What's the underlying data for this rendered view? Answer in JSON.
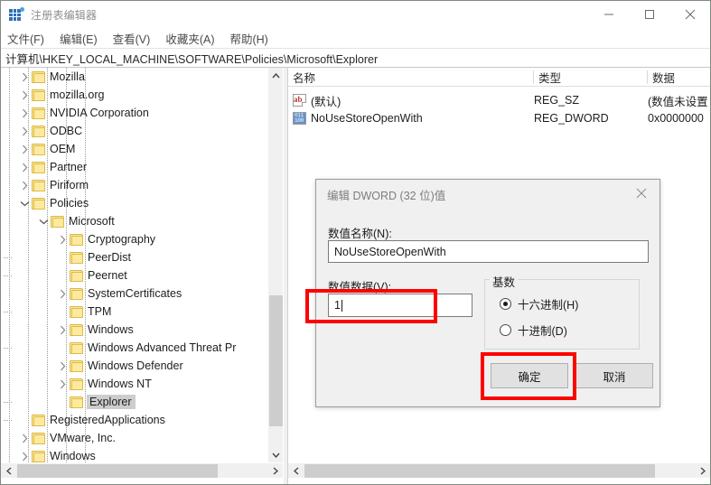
{
  "window": {
    "title": "注册表编辑器",
    "icon": "registry-editor-icon",
    "minimize_label": "—",
    "maximize_label": "□",
    "close_label": "✕"
  },
  "menubar": {
    "items": [
      {
        "label": "文件(F)",
        "text": "文件",
        "key": "F"
      },
      {
        "label": "编辑(E)",
        "text": "编辑",
        "key": "E"
      },
      {
        "label": "查看(V)",
        "text": "查看",
        "key": "V"
      },
      {
        "label": "收藏夹(A)",
        "text": "收藏夹",
        "key": "A"
      },
      {
        "label": "帮助(H)",
        "text": "帮助",
        "key": "H"
      }
    ]
  },
  "address": {
    "path": "计算机\\HKEY_LOCAL_MACHINE\\SOFTWARE\\Policies\\Microsoft\\Explorer"
  },
  "tree": {
    "nodes": [
      {
        "label": "Mozilla",
        "depth": 2,
        "expander": "collapsed",
        "selected": false
      },
      {
        "label": "mozilla.org",
        "depth": 2,
        "expander": "collapsed",
        "selected": false
      },
      {
        "label": "NVIDIA Corporation",
        "depth": 2,
        "expander": "collapsed",
        "selected": false
      },
      {
        "label": "ODBC",
        "depth": 2,
        "expander": "collapsed",
        "selected": false
      },
      {
        "label": "OEM",
        "depth": 2,
        "expander": "collapsed",
        "selected": false
      },
      {
        "label": "Partner",
        "depth": 2,
        "expander": "collapsed",
        "selected": false
      },
      {
        "label": "Piriform",
        "depth": 2,
        "expander": "collapsed",
        "selected": false
      },
      {
        "label": "Policies",
        "depth": 2,
        "expander": "expanded",
        "selected": false
      },
      {
        "label": "Microsoft",
        "depth": 3,
        "expander": "expanded",
        "selected": false
      },
      {
        "label": "Cryptography",
        "depth": 4,
        "expander": "collapsed",
        "selected": false
      },
      {
        "label": "PeerDist",
        "depth": 4,
        "expander": "none",
        "selected": false
      },
      {
        "label": "Peernet",
        "depth": 4,
        "expander": "none",
        "selected": false
      },
      {
        "label": "SystemCertificates",
        "depth": 4,
        "expander": "collapsed",
        "selected": false
      },
      {
        "label": "TPM",
        "depth": 4,
        "expander": "none",
        "selected": false
      },
      {
        "label": "Windows",
        "depth": 4,
        "expander": "collapsed",
        "selected": false
      },
      {
        "label": "Windows Advanced Threat Pr",
        "depth": 4,
        "expander": "none",
        "selected": false
      },
      {
        "label": "Windows Defender",
        "depth": 4,
        "expander": "collapsed",
        "selected": false
      },
      {
        "label": "Windows NT",
        "depth": 4,
        "expander": "collapsed",
        "selected": false
      },
      {
        "label": "Explorer",
        "depth": 4,
        "expander": "none",
        "selected": true
      },
      {
        "label": "RegisteredApplications",
        "depth": 2,
        "expander": "none",
        "selected": false
      },
      {
        "label": "VMware, Inc.",
        "depth": 2,
        "expander": "collapsed",
        "selected": false
      },
      {
        "label": "Windows",
        "depth": 2,
        "expander": "collapsed",
        "selected": false
      }
    ]
  },
  "values_list": {
    "columns": [
      {
        "label": "名称"
      },
      {
        "label": "类型"
      },
      {
        "label": "数据"
      }
    ],
    "rows": [
      {
        "name": "(默认)",
        "type": "REG_SZ",
        "data": "(数值未设置",
        "icon": "string-value-icon"
      },
      {
        "name": "NoUseStoreOpenWith",
        "type": "REG_DWORD",
        "data": "0x0000000",
        "icon": "dword-value-icon"
      }
    ]
  },
  "dialog": {
    "title": "编辑 DWORD (32 位)值",
    "close_label": "✕",
    "value_name_label": "数值名称(N):",
    "value_name": "NoUseStoreOpenWith",
    "value_data_label": "数值数据(V):",
    "value_data": "1",
    "base_group_label": "基数",
    "radios": [
      {
        "label": "十六进制(H)",
        "selected": true
      },
      {
        "label": "十进制(D)",
        "selected": false
      }
    ],
    "ok_label": "确定",
    "cancel_label": "取消"
  },
  "annotations": {
    "accent_color": "#fe0000",
    "boxes": [
      {
        "target": "value-data-input"
      },
      {
        "target": "ok-button"
      }
    ]
  }
}
